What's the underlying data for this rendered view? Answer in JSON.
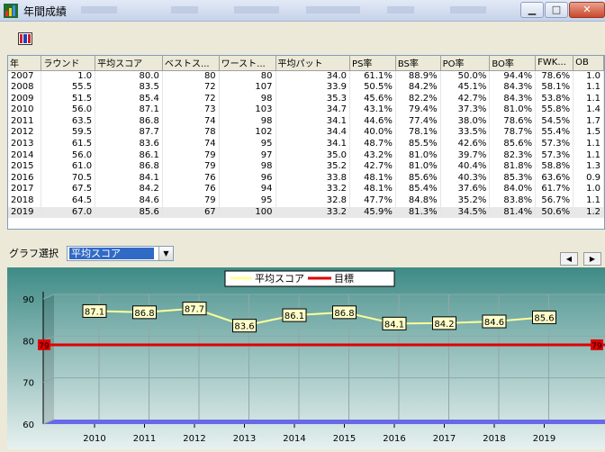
{
  "window": {
    "title": "年間成績"
  },
  "table": {
    "columns": [
      "年",
      "ラウンド",
      "平均スコア",
      "ベストス...",
      "ワースト...",
      "平均パット",
      "PS率",
      "BS率",
      "PO率",
      "BO率",
      "FWK...",
      "OB"
    ],
    "rows": [
      [
        "2007",
        "1.0",
        "80.0",
        "80",
        "80",
        "34.0",
        "61.1%",
        "88.9%",
        "50.0%",
        "94.4%",
        "78.6%",
        "1.0"
      ],
      [
        "2008",
        "55.5",
        "83.5",
        "72",
        "107",
        "33.9",
        "50.5%",
        "84.2%",
        "45.1%",
        "84.3%",
        "58.1%",
        "1.1"
      ],
      [
        "2009",
        "51.5",
        "85.4",
        "72",
        "98",
        "35.3",
        "45.6%",
        "82.2%",
        "42.7%",
        "84.3%",
        "53.8%",
        "1.1"
      ],
      [
        "2010",
        "56.0",
        "87.1",
        "73",
        "103",
        "34.7",
        "43.1%",
        "79.4%",
        "37.3%",
        "81.0%",
        "55.8%",
        "1.4"
      ],
      [
        "2011",
        "63.5",
        "86.8",
        "74",
        "98",
        "34.1",
        "44.6%",
        "77.4%",
        "38.0%",
        "78.6%",
        "54.5%",
        "1.7"
      ],
      [
        "2012",
        "59.5",
        "87.7",
        "78",
        "102",
        "34.4",
        "40.0%",
        "78.1%",
        "33.5%",
        "78.7%",
        "55.4%",
        "1.5"
      ],
      [
        "2013",
        "61.5",
        "83.6",
        "74",
        "95",
        "34.1",
        "48.7%",
        "85.5%",
        "42.6%",
        "85.6%",
        "57.3%",
        "1.1"
      ],
      [
        "2014",
        "56.0",
        "86.1",
        "79",
        "97",
        "35.0",
        "43.2%",
        "81.0%",
        "39.7%",
        "82.3%",
        "57.3%",
        "1.1"
      ],
      [
        "2015",
        "61.0",
        "86.8",
        "79",
        "98",
        "35.2",
        "42.7%",
        "81.0%",
        "40.4%",
        "81.8%",
        "58.8%",
        "1.3"
      ],
      [
        "2016",
        "70.5",
        "84.1",
        "76",
        "96",
        "33.8",
        "48.1%",
        "85.6%",
        "40.3%",
        "85.3%",
        "63.6%",
        "0.9"
      ],
      [
        "2017",
        "67.5",
        "84.2",
        "76",
        "94",
        "33.2",
        "48.1%",
        "85.4%",
        "37.6%",
        "84.0%",
        "61.7%",
        "1.0"
      ],
      [
        "2018",
        "64.5",
        "84.6",
        "79",
        "95",
        "32.8",
        "47.7%",
        "84.8%",
        "35.2%",
        "83.8%",
        "56.7%",
        "1.1"
      ],
      [
        "2019",
        "67.0",
        "85.6",
        "67",
        "100",
        "33.2",
        "45.9%",
        "81.3%",
        "34.5%",
        "81.4%",
        "50.6%",
        "1.2"
      ]
    ],
    "selected_row": 12
  },
  "graph_select": {
    "label": "グラフ選択",
    "value": "平均スコア"
  },
  "chart_data": {
    "type": "line",
    "x": [
      "2010",
      "2011",
      "2012",
      "2013",
      "2014",
      "2015",
      "2016",
      "2017",
      "2018",
      "2019"
    ],
    "series": [
      {
        "name": "平均スコア",
        "values": [
          87.1,
          86.8,
          87.7,
          83.6,
          86.1,
          86.8,
          84.1,
          84.2,
          84.6,
          85.6
        ],
        "color": "#ffff99"
      },
      {
        "name": "目標",
        "values": [
          79,
          79,
          79,
          79,
          79,
          79,
          79,
          79,
          79,
          79
        ],
        "color": "#e00000"
      }
    ],
    "ylim": [
      60,
      90
    ],
    "yticks": [
      60,
      70,
      80,
      90
    ],
    "grid": true,
    "legend": "top-center",
    "target_label_left": "79",
    "target_label_right": "79"
  }
}
